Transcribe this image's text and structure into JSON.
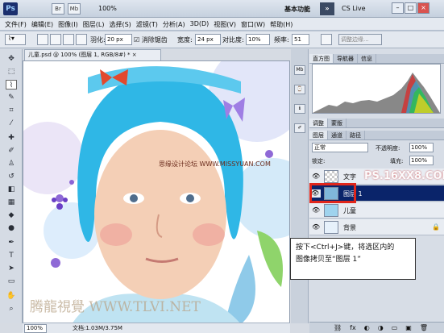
{
  "app": {
    "logo": "Ps",
    "icons": [
      "Br",
      "Mb"
    ],
    "zoom": "100%",
    "workspace": "基本功能",
    "cs_live": "CS Live"
  },
  "menu": [
    "文件(F)",
    "编辑(E)",
    "图像(I)",
    "图层(L)",
    "选择(S)",
    "滤镜(T)",
    "分析(A)",
    "3D(D)",
    "视图(V)",
    "窗口(W)",
    "帮助(H)"
  ],
  "options": {
    "feather_label": "羽化:",
    "feather_value": "20 px",
    "antialias_label": "消除锯齿",
    "width_label": "宽度:",
    "width_value": "24 px",
    "contrast_label": "对比度:",
    "contrast_value": "10%",
    "frequency_label": "频率:",
    "frequency_value": "51",
    "refine_edge": "调整边缘..."
  },
  "document": {
    "tab": "儿童.psd @ 100% (图层 1, RGB/8#) * ×",
    "watermark_center": "思缘设计论坛 WWW.MISSYUAN.COM",
    "watermark_bottom": "腾龍視覺 WWW.TLVI.NET",
    "zoom": "100%",
    "doc_size": "文档:1.03M/3.75M"
  },
  "panels": {
    "histogram_tabs": [
      "直方图",
      "导航器",
      "信息"
    ],
    "adjust_tabs": [
      "调整",
      "蒙版"
    ],
    "layer_tabs": [
      "图层",
      "通道",
      "路径"
    ],
    "blend_mode": "正常",
    "opacity_label": "不透明度:",
    "opacity_value": "100%",
    "lock_label": "锁定:",
    "fill_label": "填充:",
    "fill_value": "100%",
    "watermark_layers": "PS.16XX8.COM",
    "layers": [
      {
        "name": "文字",
        "selected": false
      },
      {
        "name": "图层 1",
        "selected": true
      },
      {
        "name": "儿童",
        "selected": false
      },
      {
        "name": "背景",
        "selected": false
      }
    ]
  },
  "callout": {
    "line1": "按下<Ctrl+J>键，将选区内的",
    "line2": "图像拷贝至“图层 1”"
  },
  "colors": {
    "selected_layer": "#0a246a",
    "highlight_box": "#e0261b",
    "hat": "#2fb7e6"
  }
}
